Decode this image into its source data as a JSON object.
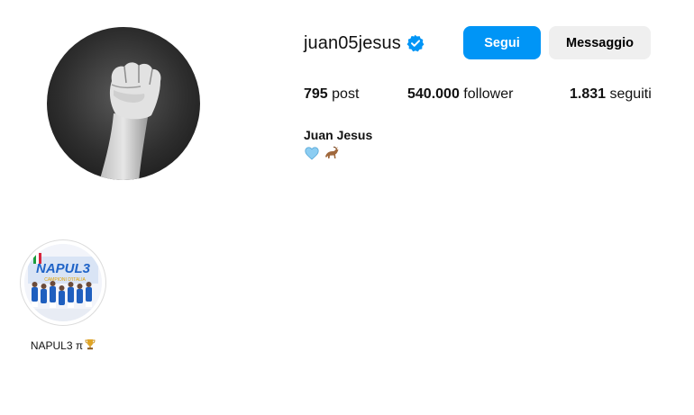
{
  "profile": {
    "username": "juan05jesus",
    "verified": true,
    "full_name": "Juan Jesus",
    "bio_emoji": [
      "blue-heart",
      "goat"
    ]
  },
  "actions": {
    "follow_label": "Segui",
    "message_label": "Messaggio"
  },
  "stats": {
    "posts_count": "795",
    "posts_label": "post",
    "followers_count": "540.000",
    "followers_label": "follower",
    "following_count": "1.831",
    "following_label": "seguiti"
  },
  "highlights": [
    {
      "label": "NAPUL3 π",
      "icon": "trophy-icon",
      "cover_text": "NAPUL3",
      "cover_subtext": "CAMPIONI D'ITALIA"
    }
  ],
  "colors": {
    "accent": "#0095f6",
    "secondary_button": "#efefef",
    "verified": "#0095f6"
  }
}
